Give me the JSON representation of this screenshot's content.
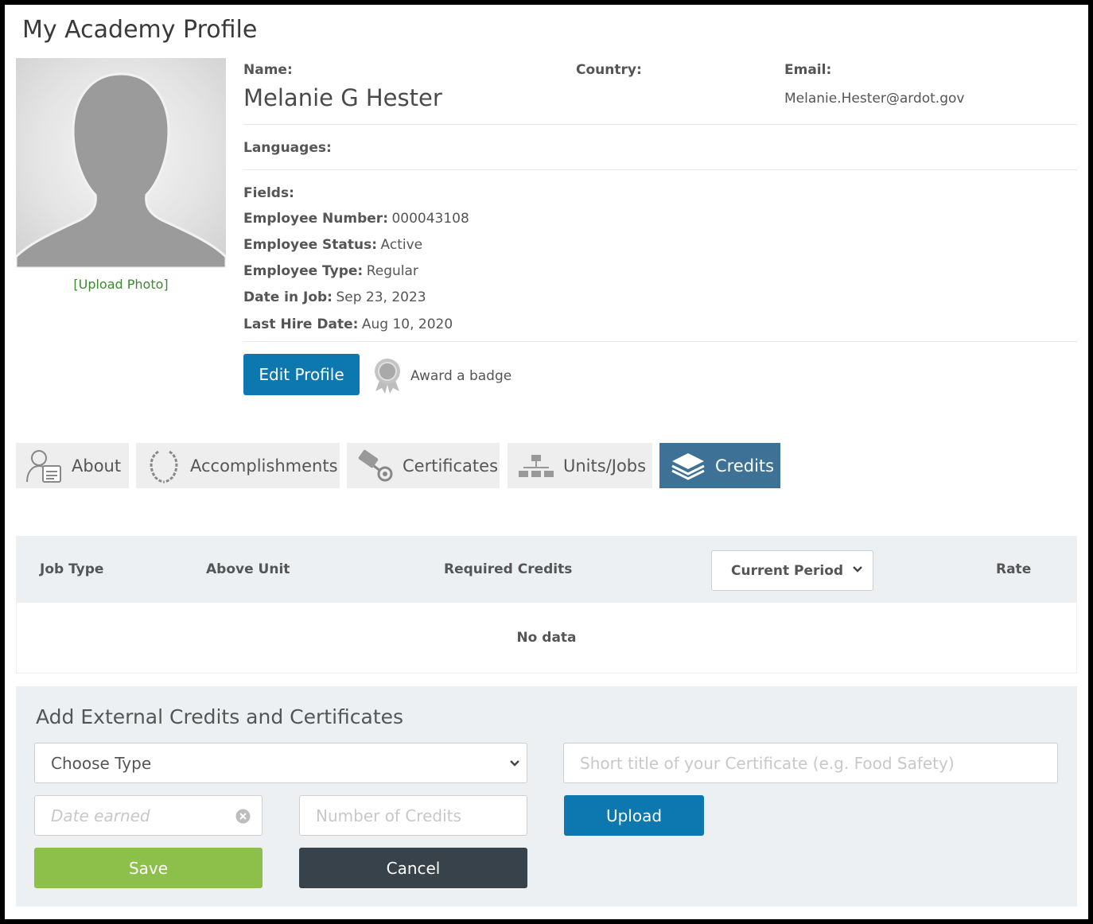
{
  "page": {
    "title": "My Academy Profile"
  },
  "photo": {
    "upload_label": "[Upload Photo]"
  },
  "profile": {
    "name_label": "Name:",
    "name": "Melanie G Hester",
    "country_label": "Country:",
    "country": "",
    "email_label": "Email:",
    "email": "Melanie.Hester@ardot.gov",
    "languages_label": "Languages:",
    "fields_label": "Fields:",
    "fields": [
      {
        "label": "Employee Number:",
        "value": "000043108"
      },
      {
        "label": "Employee Status:",
        "value": "Active"
      },
      {
        "label": "Employee Type:",
        "value": "Regular"
      },
      {
        "label": "Date in Job:",
        "value": "Sep 23, 2023"
      },
      {
        "label": "Last Hire Date:",
        "value": "Aug 10, 2020"
      }
    ]
  },
  "actions": {
    "edit_profile": "Edit Profile",
    "award_badge": "Award a badge"
  },
  "tabs": [
    {
      "label": "About",
      "icon": "user-card-icon"
    },
    {
      "label": "Accomplishments",
      "icon": "laurel-icon"
    },
    {
      "label": "Certificates",
      "icon": "certificate-icon"
    },
    {
      "label": "Units/Jobs",
      "icon": "org-chart-icon"
    },
    {
      "label": "Credits",
      "icon": "layers-icon",
      "active": true
    }
  ],
  "credits_table": {
    "columns": [
      "Job Type",
      "Above Unit",
      "Required Credits",
      "Rate"
    ],
    "period_select": "Current Period",
    "empty_text": "No data"
  },
  "external": {
    "title": "Add External Credits and Certificates",
    "type_select": "Choose Type",
    "title_placeholder": "Short title of your Certificate (e.g. Food Safety)",
    "date_placeholder": "Date earned",
    "credits_placeholder": "Number of Credits",
    "upload_label": "Upload",
    "save_label": "Save",
    "cancel_label": "Cancel"
  },
  "colors": {
    "primary": "#0d77b0",
    "active_tab": "#3d7196",
    "save": "#8dc04a",
    "cancel": "#37424a",
    "link": "#3b8a2e"
  }
}
